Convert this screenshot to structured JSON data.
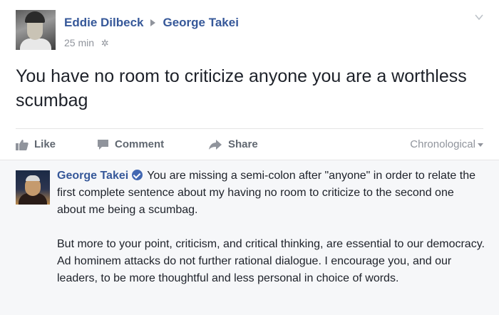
{
  "post": {
    "author": "Eddie Dilbeck",
    "target": "George Takei",
    "time": "25 min",
    "text": "You have no room to criticize anyone you are a worthless scumbag",
    "icons": {
      "privacy": "gear-icon",
      "menu": "chevron-down-icon"
    }
  },
  "actions": {
    "like": "Like",
    "comment": "Comment",
    "share": "Share",
    "sort": "Chronological"
  },
  "comment": {
    "author": "George Takei",
    "verified": true,
    "paragraph1": "You are missing a semi-colon after \"anyone\" in order to relate the first complete sentence about my having no room to criticize to the second one about me being a scumbag.",
    "paragraph2": "But more to your point, criticism, and critical thinking, are essential to our democracy. Ad hominem attacks do not further rational dialogue. I encourage you, and our leaders, to be more thoughtful and less personal in choice of words."
  },
  "colors": {
    "link": "#365899",
    "text": "#1d2129",
    "muted": "#90949c",
    "comment_bg": "#f6f7f9"
  }
}
